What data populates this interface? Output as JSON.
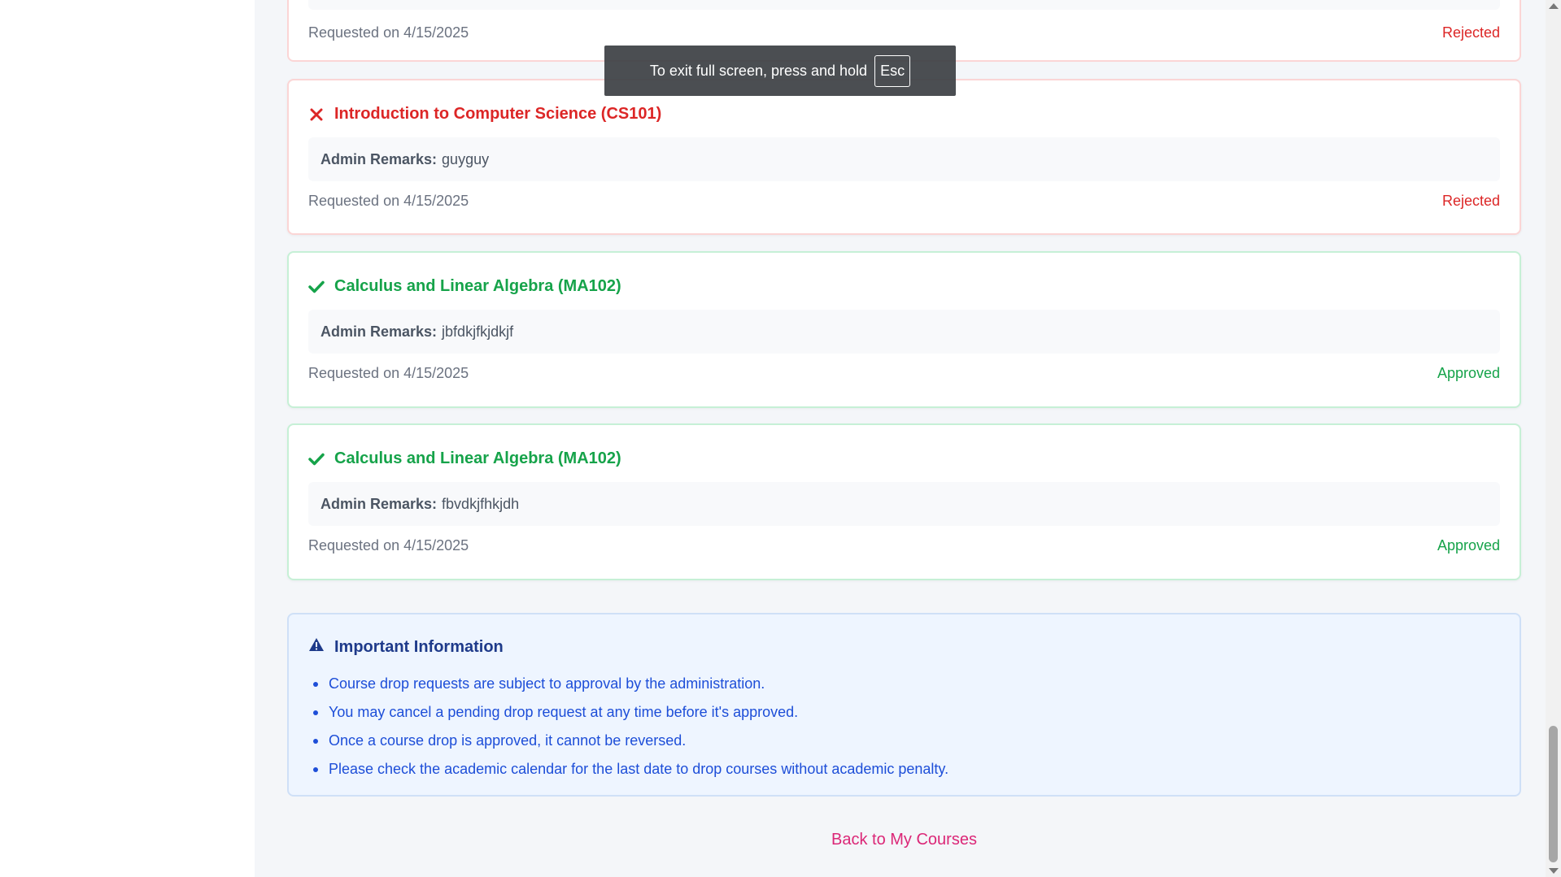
{
  "requests": [
    {
      "course": "",
      "remarks_label": "",
      "remarks": "",
      "requested_on": "Requested on 4/15/2025",
      "status": "Rejected",
      "state": "rejected"
    },
    {
      "course": "Introduction to Computer Science (CS101)",
      "remarks_label": "Admin Remarks:",
      "remarks": "guyguy",
      "requested_on": "Requested on 4/15/2025",
      "status": "Rejected",
      "state": "rejected",
      "icon": "x-icon"
    },
    {
      "course": "Calculus and Linear Algebra (MA102)",
      "remarks_label": "Admin Remarks:",
      "remarks": "jbfdkjfkjdkjf",
      "requested_on": "Requested on 4/15/2025",
      "status": "Approved",
      "state": "approved",
      "icon": "check-icon"
    },
    {
      "course": "Calculus and Linear Algebra (MA102)",
      "remarks_label": "Admin Remarks:",
      "remarks": "fbvdkjfhkjdh",
      "requested_on": "Requested on 4/15/2025",
      "status": "Approved",
      "state": "approved",
      "icon": "check-icon"
    }
  ],
  "info": {
    "title": "Important Information",
    "icon": "warning-icon",
    "items": [
      "Course drop requests are subject to approval by the administration.",
      "You may cancel a pending drop request at any time before it's approved.",
      "Once a course drop is approved, it cannot be reversed.",
      "Please check the academic calendar for the last date to drop courses without academic penalty."
    ]
  },
  "back_link": "Back to My Courses",
  "fullscreen_toast": {
    "message": "To exit full screen, press and hold",
    "key": "Esc"
  },
  "colors": {
    "rejected": "#dc2626",
    "approved": "#16a34a",
    "info": "#1e40af",
    "link": "#db2777"
  }
}
